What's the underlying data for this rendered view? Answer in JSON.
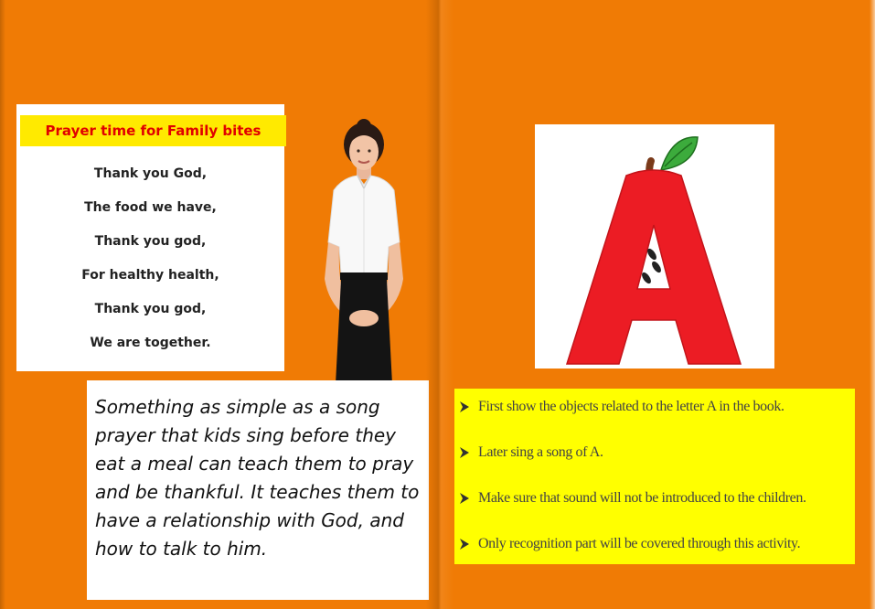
{
  "left_page": {
    "prayer": {
      "title": "Prayer time for Family bites",
      "lines": [
        "Thank you God,",
        "The food we have,",
        "Thank you god,",
        "For healthy health,",
        "Thank you god,",
        "We are together."
      ]
    },
    "quote": "Something as simple as a song prayer that kids sing before they eat a meal can teach them to pray and be thankful. It teaches them to have a relationship with God, and how to talk to him."
  },
  "right_page": {
    "letter": "A",
    "instructions": [
      "First  show the objects related to the letter A in the book.",
      "Later sing a song of A.",
      "Make sure that sound will not be introduced to the children.",
      "Only recognition  part will be covered through this activity."
    ]
  },
  "colors": {
    "page_background": "#f07b05",
    "title_highlight": "#ffea00",
    "title_text": "#e00000",
    "instructions_background": "#ffff00",
    "letter_red": "#ec1c24",
    "leaf_green": "#3cab3c"
  },
  "icons": [
    "arrow-bullet-icon",
    "apple-letter-a-icon",
    "woman-illustration"
  ]
}
